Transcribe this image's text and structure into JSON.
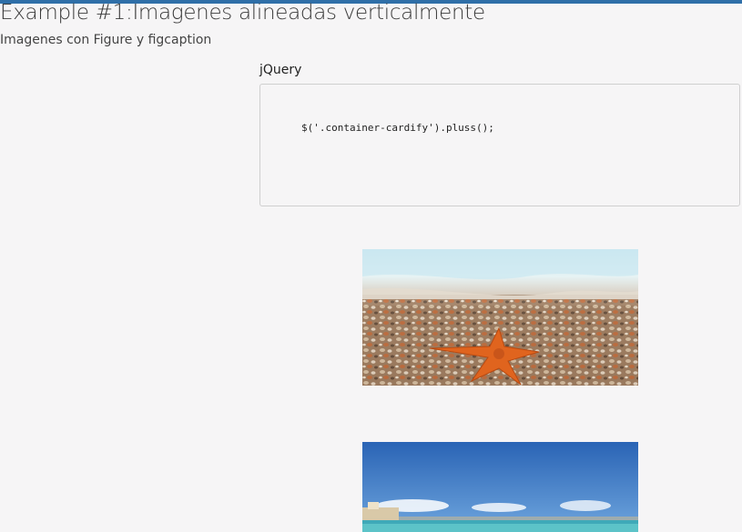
{
  "header": {
    "title": "Example #1:Imagenes alineadas verticalmente",
    "subtitle": "Imagenes con Figure y figcaption"
  },
  "code_section": {
    "label": "jQuery",
    "code": "$('.container-cardify').pluss();"
  },
  "figures": [
    {
      "name": "starfish-on-pebble-beach-image"
    },
    {
      "name": "sunny-beach-with-sea-image"
    }
  ],
  "colors": {
    "topbar": "#2f6fa8",
    "background": "#f6f5f6"
  }
}
